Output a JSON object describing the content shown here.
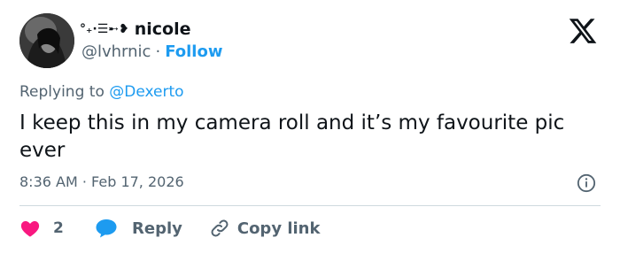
{
  "author": {
    "name_decoration": "°₊⋅☰➸❥",
    "display_name": "nicole",
    "handle": "@lvhrnic",
    "separator": "·",
    "follow_label": "Follow"
  },
  "reply_to": {
    "prefix": "Replying to",
    "mention": "@Dexerto"
  },
  "tweet": {
    "text": "I keep this in my camera roll and it’s my favourite pic ever",
    "timestamp": "8:36 AM · Feb 17, 2026"
  },
  "actions": {
    "like_count": "2",
    "reply_label": "Reply",
    "copy_link_label": "Copy link"
  },
  "colors": {
    "accent": "#1d9bf0",
    "like": "#f91880",
    "muted": "#536471",
    "text": "#0f1419"
  },
  "icons": [
    "x-logo-icon",
    "info-icon",
    "heart-icon",
    "reply-bubble-icon",
    "link-icon"
  ]
}
